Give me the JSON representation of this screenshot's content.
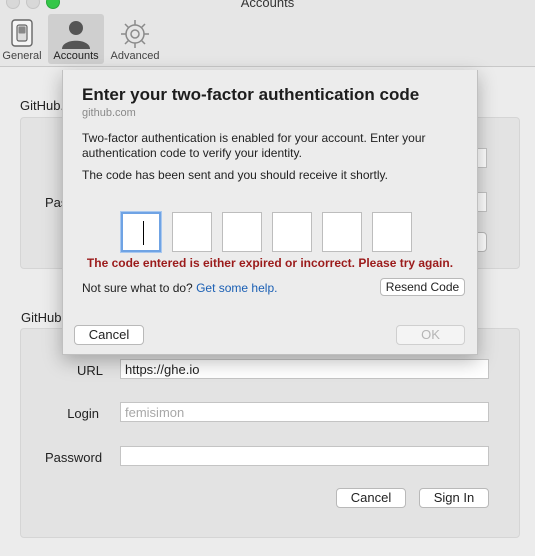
{
  "window": {
    "title": "Accounts"
  },
  "toolbar": {
    "items": [
      {
        "label": "General",
        "icon": "switch-icon"
      },
      {
        "label": "Accounts",
        "icon": "person-icon",
        "selected": true
      },
      {
        "label": "Advanced",
        "icon": "gear-icon"
      }
    ]
  },
  "dotcom": {
    "section_label": "GitHub.com",
    "password_label": "Password"
  },
  "enterprise": {
    "section_label": "GitHub Enterprise",
    "url_label": "URL",
    "url_value": "https://ghe.io",
    "login_label": "Login",
    "login_placeholder": "femisimon",
    "password_label": "Password",
    "password_value": "",
    "cancel_label": "Cancel",
    "signin_label": "Sign In"
  },
  "sheet": {
    "title": "Enter your two-factor authentication code",
    "subtitle": "github.com",
    "description": "Two-factor authentication is enabled for your account. Enter your authentication code to verify your identity.",
    "sent_message": "The code has been sent and you should receive it shortly.",
    "code_digits": [
      "",
      "",
      "",
      "",
      "",
      ""
    ],
    "error_message": "The code entered is either expired or incorrect. Please try again.",
    "help_text": "Not sure what to do?",
    "help_link": "Get some help.",
    "resend_label": "Resend Code",
    "cancel_label": "Cancel",
    "ok_label": "OK"
  },
  "colors": {
    "error": "#9b1b1b",
    "link": "#1a5fb4",
    "focus_ring": "#6fa3e4",
    "zoom_button": "#33c748"
  }
}
